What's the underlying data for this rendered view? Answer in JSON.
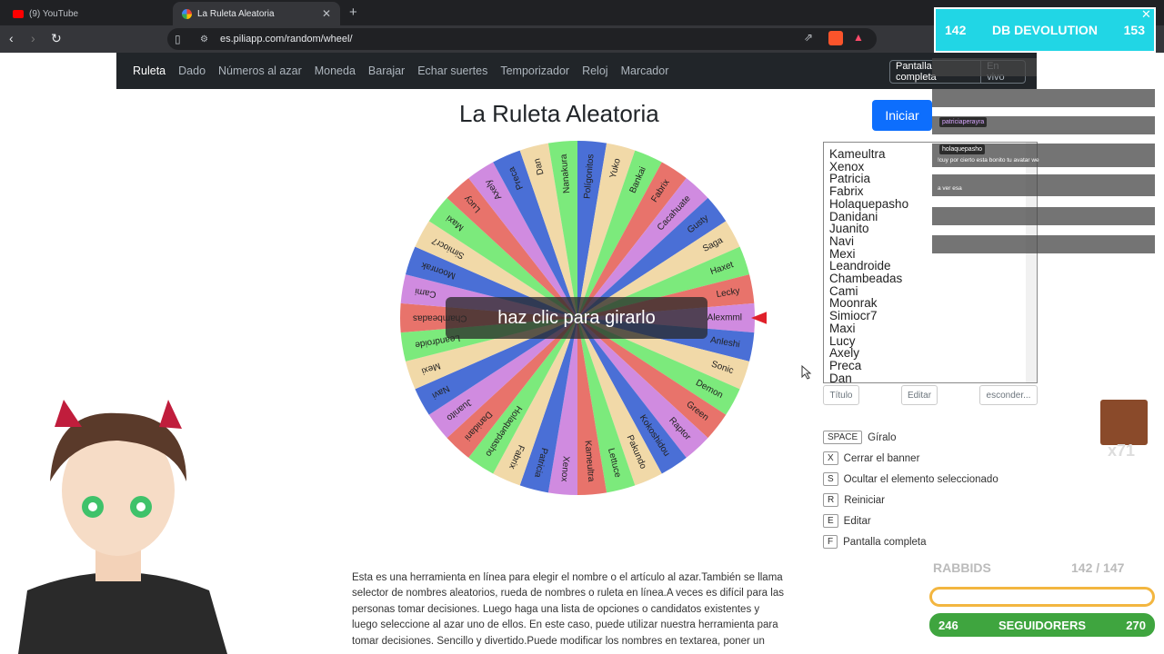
{
  "browser": {
    "tabs": [
      {
        "label": "(9) YouTube"
      },
      {
        "label": "La Ruleta Aleatoria"
      }
    ],
    "url": "es.piliapp.com/random/wheel/"
  },
  "nav": {
    "items": [
      "Ruleta",
      "Dado",
      "Números al azar",
      "Moneda",
      "Barajar",
      "Echar suertes",
      "Temporizador",
      "Reloj",
      "Marcador"
    ],
    "fullscreen_label": "Pantalla completa",
    "live_label": "En vivo"
  },
  "page": {
    "title": "La Ruleta Aleatoria",
    "start_button": "Iniciar",
    "spin_hint": "haz clic para girarlo"
  },
  "wheel": {
    "segments": [
      "Polígonitos",
      "Yuko",
      "Bankai",
      "Fabrix",
      "Cacahuate",
      "Gusty",
      "Saga",
      "Haxet",
      "Lecky",
      "Alexmml",
      "Anleshi",
      "Sonic",
      "Demon",
      "Green",
      "Raptor",
      "Kokoshidou",
      "Pakundo",
      "Lettuce",
      "Kameultra",
      "Xenox",
      "Patricia",
      "Fabrix",
      "Holaquepasho",
      "Danidani",
      "Juanito",
      "Navi",
      "Mexi",
      "Leandroide",
      "Chambeadas",
      "Cami",
      "Moonrak",
      "Simiocr7",
      "Maxi",
      "Lucy",
      "Axely",
      "Preca",
      "Dan",
      "Nanakura"
    ],
    "colors": [
      "#4a6fd6",
      "#f1d9a8",
      "#7cea7c",
      "#e8736b",
      "#d08be0"
    ]
  },
  "namelist": {
    "names": [
      "Kameultra",
      "Xenox",
      "Patricia",
      "Fabrix",
      "Holaquepasho",
      "Danidani",
      "Juanito",
      "Navi",
      "Mexi",
      "Leandroide",
      "Chambeadas",
      "Cami",
      "Moonrak",
      "Simiocr7",
      "Maxi",
      "Lucy",
      "Axely",
      "Preca",
      "Dan"
    ],
    "title_btn": "Título",
    "edit_btn": "Editar",
    "hide_btn": "esconder..."
  },
  "shortcuts": [
    {
      "key": "SPACE",
      "label": "Gíralo"
    },
    {
      "key": "X",
      "label": "Cerrar el banner"
    },
    {
      "key": "S",
      "label": "Ocultar el elemento seleccionado"
    },
    {
      "key": "R",
      "label": "Reiniciar"
    },
    {
      "key": "E",
      "label": "Editar"
    },
    {
      "key": "F",
      "label": "Pantalla completa"
    }
  ],
  "description": [
    "Esta es una herramienta en línea para elegir el nombre o el artículo al azar.También se llama",
    "selector de nombres aleatorios, rueda de nombres o ruleta en línea.A veces es difícil para las",
    "personas tomar decisiones. Luego haga una lista de opciones o candidatos existentes y",
    "luego seleccione al azar uno de ellos. En este caso, puede utilizar nuestra herramienta para",
    "tomar decisiones. Sencillo y divertido.Puede modificar los nombres en textarea, poner un"
  ],
  "stream": {
    "banner_left": "142",
    "banner_title": "DB DEVOLUTION",
    "banner_right": "153",
    "chat": [
      {
        "user": "patriciaperayra",
        "msg": ""
      },
      {
        "user": "holaquepasho",
        "msg": "!cuy por cierto esta bonito tu avatar we"
      },
      {
        "user": "",
        "msg": "a ver esa"
      }
    ],
    "rabbids_label": "RABBIDS",
    "rabbids_count": "142 / 147",
    "emote_count": "x71",
    "followers_left": "246",
    "followers_label": "SEGUIDORERS",
    "followers_right": "270"
  }
}
